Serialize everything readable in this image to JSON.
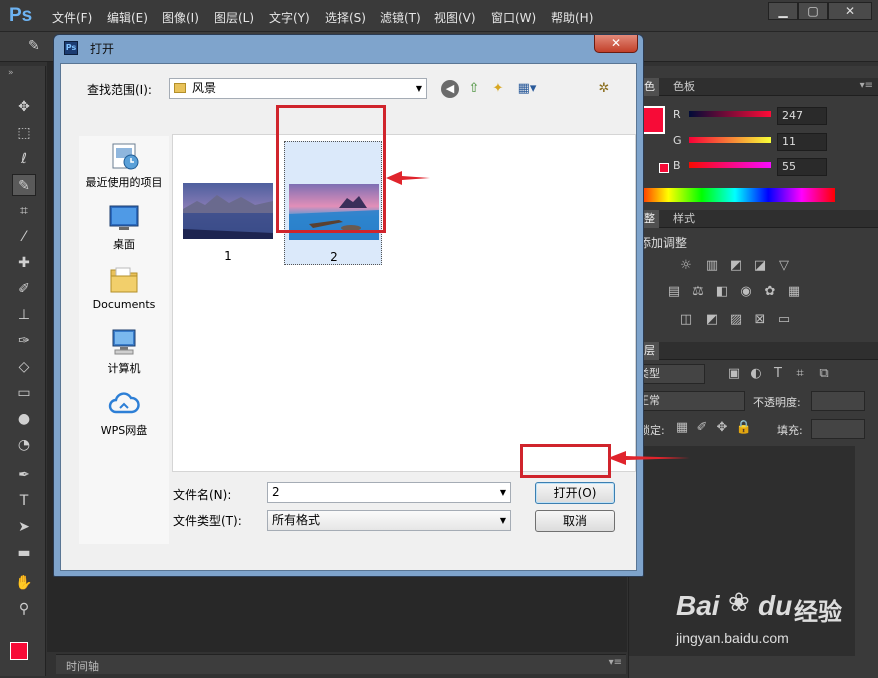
{
  "app": {
    "logo": "Ps",
    "menus": [
      "文件(F)",
      "编辑(E)",
      "图像(I)",
      "图层(L)",
      "文字(Y)",
      "选择(S)",
      "滤镜(T)",
      "视图(V)",
      "窗口(W)",
      "帮助(H)"
    ],
    "window_controls": [
      "▁",
      "▢",
      "✕"
    ]
  },
  "dialog": {
    "title": "打开",
    "close": "✕",
    "look_in_label": "查找范围(I):",
    "look_in_value": "风景",
    "places": [
      {
        "label": "最近使用的项目",
        "icon": "recent-items-icon"
      },
      {
        "label": "桌面",
        "icon": "desktop-icon"
      },
      {
        "label": "Documents",
        "icon": "folder-icon"
      },
      {
        "label": "计算机",
        "icon": "computer-icon"
      },
      {
        "label": "WPS网盘",
        "icon": "cloud-drive-icon"
      }
    ],
    "files": [
      {
        "label": "1",
        "selected": false
      },
      {
        "label": "2",
        "selected": true
      }
    ],
    "filename_label": "文件名(N):",
    "filename_value": "2",
    "filetype_label": "文件类型(T):",
    "filetype_value": "所有格式",
    "open_button": "打开(O)",
    "cancel_button": "取消"
  },
  "panels": {
    "color_tabs": [
      "颜色",
      "色板"
    ],
    "rgb": [
      {
        "label": "R",
        "value": "247"
      },
      {
        "label": "G",
        "value": "11"
      },
      {
        "label": "B",
        "value": "55"
      }
    ],
    "swatch_color": "#f70b37",
    "adjust_tabs": [
      "调整",
      "样式"
    ],
    "adjust_title": "添加调整",
    "layers_tab": "图层",
    "layers_kind": "类型",
    "blend_mode": "正常",
    "opacity_label": "不透明度:",
    "lock_label": "锁定:",
    "fill_label": "填充:"
  },
  "timeline": {
    "label": "时间轴"
  },
  "watermark": {
    "brand": "Bai",
    "brand2": "du",
    "product": "经验",
    "url": "jingyan.baidu.com"
  }
}
